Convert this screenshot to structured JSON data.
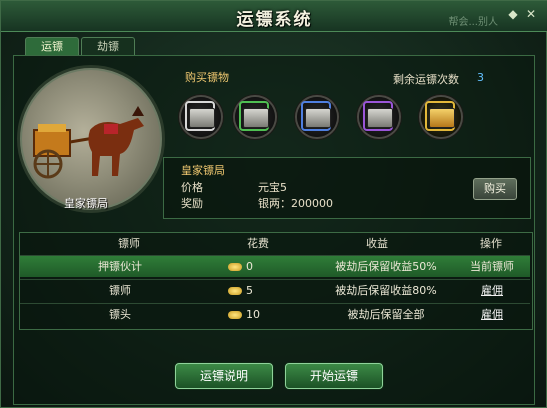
{
  "window": {
    "title": "运镖系统",
    "ghost_text": "帮会...别人"
  },
  "tabs": [
    {
      "label": "运镖"
    },
    {
      "label": "劫镖"
    }
  ],
  "escort_company": {
    "name": "皇家镖局"
  },
  "purchase": {
    "section_title": "购买镖物",
    "remaining_label": "剩余运镖次数",
    "remaining_count": "3",
    "cargo_slots": [
      {
        "tier": "white",
        "color": "#d8d8d8",
        "selected": false
      },
      {
        "tier": "green",
        "color": "#4fbf52",
        "selected": false
      },
      {
        "tier": "blue",
        "color": "#4f7fe0",
        "selected": false
      },
      {
        "tier": "purple",
        "color": "#9a55d8",
        "selected": false
      },
      {
        "tier": "gold",
        "color": "#e2b73a",
        "selected": true
      }
    ]
  },
  "selected_info": {
    "name": "皇家镖局",
    "price_label": "价格",
    "price_value": "元宝5",
    "reward_label": "奖励",
    "reward_value": "银两：200000",
    "buy_button": "购买"
  },
  "table": {
    "headers": [
      "镖师",
      "花费",
      "收益",
      "操作"
    ],
    "rows": [
      {
        "name": "押镖伙计",
        "cost": "0",
        "income": "被劫后保留收益50%",
        "action": "当前镖师",
        "selected": true
      },
      {
        "name": "镖师",
        "cost": "5",
        "income": "被劫后保留收益80%",
        "action": "雇佣",
        "selected": false
      },
      {
        "name": "镖头",
        "cost": "10",
        "income": "被劫后保留全部",
        "action": "雇佣",
        "selected": false
      }
    ]
  },
  "footer": {
    "help_button": "运镖说明",
    "start_button": "开始运镖"
  },
  "colors": {
    "accent_green": "#2f7d38",
    "gold_text": "#f0c870",
    "count_blue": "#63c0ff"
  }
}
